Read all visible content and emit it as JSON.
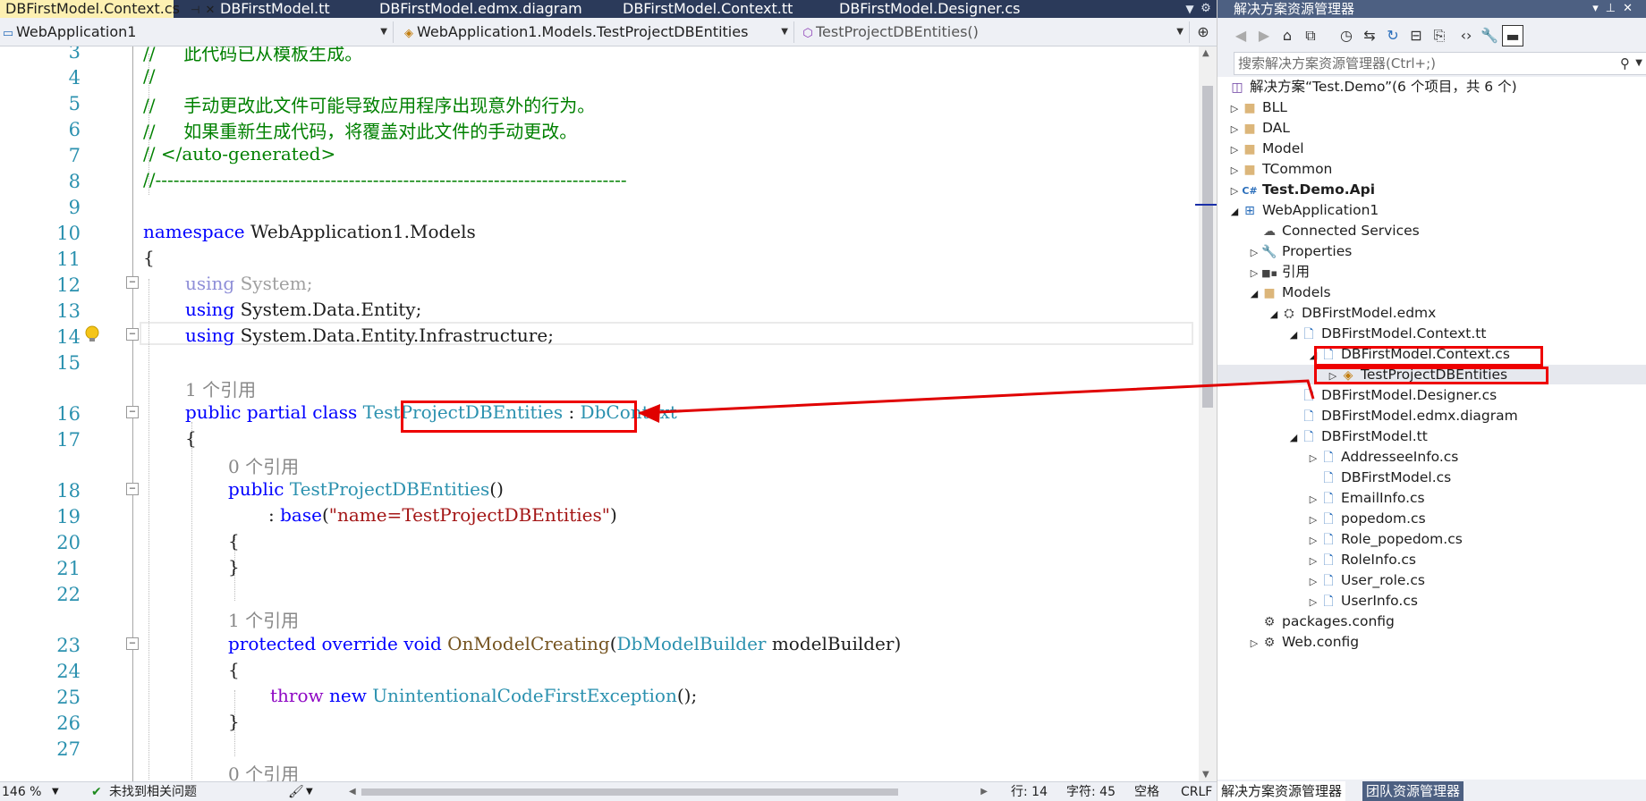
{
  "editor": {
    "tabs": [
      {
        "label": "DBFirstModel.Context.cs",
        "active": true
      },
      {
        "label": "DBFirstModel.tt",
        "active": false
      },
      {
        "label": "DBFirstModel.edmx.diagram",
        "active": false
      },
      {
        "label": "DBFirstModel.Context.tt",
        "active": false
      },
      {
        "label": "DBFirstModel.Designer.cs",
        "active": false
      }
    ],
    "nav": {
      "project": "WebApplication1",
      "type": "WebApplication1.Models.TestProjectDBEntities",
      "member": "TestProjectDBEntities()"
    },
    "lines": [
      {
        "n": "3",
        "segments": [
          {
            "t": "//     此代码已从模板生成。",
            "c": "cm"
          }
        ]
      },
      {
        "n": "4",
        "segments": [
          {
            "t": "//",
            "c": "cm"
          }
        ]
      },
      {
        "n": "5",
        "segments": [
          {
            "t": "//     手动更改此文件可能导致应用程序出现意外的行为。",
            "c": "cm"
          }
        ]
      },
      {
        "n": "6",
        "segments": [
          {
            "t": "//     如果重新生成代码，将覆盖对此文件的手动更改。",
            "c": "cm"
          }
        ]
      },
      {
        "n": "7",
        "segments": [
          {
            "t": "// </auto-generated>",
            "c": "cm"
          }
        ]
      },
      {
        "n": "8",
        "segments": [
          {
            "t": "//------------------------------------------------------------------------------",
            "c": "cm"
          }
        ]
      },
      {
        "n": "9",
        "segments": []
      },
      {
        "n": "10",
        "segments": [
          {
            "t": "namespace ",
            "c": "kw"
          },
          {
            "t": "WebApplication1.Models",
            "c": ""
          }
        ]
      },
      {
        "n": "11",
        "segments": [
          {
            "t": "{",
            "c": ""
          }
        ]
      },
      {
        "n": "12",
        "segments": [
          {
            "t": "using ",
            "c": "dim"
          },
          {
            "t": "System;",
            "c": "dimt"
          }
        ]
      },
      {
        "n": "13",
        "segments": [
          {
            "t": "using ",
            "c": "kw"
          },
          {
            "t": "System.Data.Entity;",
            "c": ""
          }
        ]
      },
      {
        "n": "14",
        "segments": [
          {
            "t": "using ",
            "c": "kw"
          },
          {
            "t": "System.Data.Entity.Infrastructure;",
            "c": ""
          }
        ]
      },
      {
        "n": "15",
        "segments": []
      },
      {
        "n": "16",
        "segments": [
          {
            "t": "public partial class ",
            "c": "kw"
          },
          {
            "t": "TestProjectDBEntities",
            "c": "ty"
          },
          {
            "t": " : ",
            "c": ""
          },
          {
            "t": "DbContext",
            "c": "ty"
          }
        ]
      },
      {
        "n": "17",
        "segments": [
          {
            "t": "{",
            "c": ""
          }
        ]
      },
      {
        "n": "18",
        "segments": [
          {
            "t": "public ",
            "c": "kw"
          },
          {
            "t": "TestProjectDBEntities",
            "c": "ty"
          },
          {
            "t": "()",
            "c": ""
          }
        ]
      },
      {
        "n": "19",
        "segments": [
          {
            "t": ": ",
            "c": ""
          },
          {
            "t": "base",
            "c": "kw"
          },
          {
            "t": "(",
            "c": ""
          },
          {
            "t": "\"name=TestProjectDBEntities\"",
            "c": "st"
          },
          {
            "t": ")",
            "c": ""
          }
        ]
      },
      {
        "n": "20",
        "segments": [
          {
            "t": "{",
            "c": ""
          }
        ]
      },
      {
        "n": "21",
        "segments": [
          {
            "t": "}",
            "c": ""
          }
        ]
      },
      {
        "n": "22",
        "segments": []
      },
      {
        "n": "23",
        "segments": [
          {
            "t": "protected override void ",
            "c": "kw"
          },
          {
            "t": "OnModelCreating",
            "c": "mt"
          },
          {
            "t": "(",
            "c": ""
          },
          {
            "t": "DbModelBuilder",
            "c": "ty"
          },
          {
            "t": " modelBuilder)",
            "c": ""
          }
        ]
      },
      {
        "n": "24",
        "segments": [
          {
            "t": "{",
            "c": ""
          }
        ]
      },
      {
        "n": "25",
        "segments": [
          {
            "t": "throw ",
            "c": "kc"
          },
          {
            "t": "new ",
            "c": "kw"
          },
          {
            "t": "UnintentionalCodeFirstException",
            "c": "ty"
          },
          {
            "t": "();",
            "c": ""
          }
        ]
      },
      {
        "n": "26",
        "segments": [
          {
            "t": "}",
            "c": ""
          }
        ]
      },
      {
        "n": "27",
        "segments": []
      }
    ],
    "refs": {
      "r1": "1 个引用",
      "r0": "0 个引用",
      "r1b": "1 个引用",
      "r0b": "0 个引用"
    },
    "status": {
      "zoom": "146 %",
      "issues": "未找到相关问题",
      "line": "行: 14",
      "char": "字符: 45",
      "indent": "空格",
      "eol": "CRLF"
    }
  },
  "solution_explorer": {
    "title": "解决方案资源管理器",
    "search_placeholder": "搜索解决方案资源管理器(Ctrl+;)",
    "nodes": [
      {
        "label": "解决方案“Test.Demo”(6 个项目，共 6 个)",
        "icon": "solution-icon"
      },
      {
        "label": "BLL",
        "icon": "folder-icon"
      },
      {
        "label": "DAL",
        "icon": "folder-icon"
      },
      {
        "label": "Model",
        "icon": "folder-icon"
      },
      {
        "label": "TCommon",
        "icon": "folder-icon"
      },
      {
        "label": "Test.Demo.Api",
        "icon": "csharp-project-icon"
      },
      {
        "label": "WebApplication1",
        "icon": "web-project-icon"
      },
      {
        "label": "Connected Services",
        "icon": "cloud-icon"
      },
      {
        "label": "Properties",
        "icon": "wrench-icon"
      },
      {
        "label": "引用",
        "icon": "references-icon"
      },
      {
        "label": "Models",
        "icon": "folder-icon"
      },
      {
        "label": "DBFirstModel.edmx",
        "icon": "edmx-icon"
      },
      {
        "label": "DBFirstModel.Context.tt",
        "icon": "tt-file-icon"
      },
      {
        "label": "DBFirstModel.Context.cs",
        "icon": "cs-file-icon"
      },
      {
        "label": "TestProjectDBEntities",
        "icon": "class-icon"
      },
      {
        "label": "DBFirstModel.Designer.cs",
        "icon": "cs-file-icon"
      },
      {
        "label": "DBFirstModel.edmx.diagram",
        "icon": "file-icon"
      },
      {
        "label": "DBFirstModel.tt",
        "icon": "tt-file-icon"
      },
      {
        "label": "AddresseeInfo.cs",
        "icon": "cs-file-icon"
      },
      {
        "label": "DBFirstModel.cs",
        "icon": "cs-file-icon"
      },
      {
        "label": "EmailInfo.cs",
        "icon": "cs-file-icon"
      },
      {
        "label": "popedom.cs",
        "icon": "cs-file-icon"
      },
      {
        "label": "Role_popedom.cs",
        "icon": "cs-file-icon"
      },
      {
        "label": "RoleInfo.cs",
        "icon": "cs-file-icon"
      },
      {
        "label": "User_role.cs",
        "icon": "cs-file-icon"
      },
      {
        "label": "UserInfo.cs",
        "icon": "cs-file-icon"
      },
      {
        "label": "packages.config",
        "icon": "config-icon"
      },
      {
        "label": "Web.config",
        "icon": "config-icon"
      }
    ],
    "bottom_tabs": [
      "解决方案资源管理器",
      "团队资源管理器"
    ]
  },
  "colors": {
    "highlight": "#e00000",
    "tab_active": "#fdf0b2",
    "title_bar": "#4d6082"
  }
}
